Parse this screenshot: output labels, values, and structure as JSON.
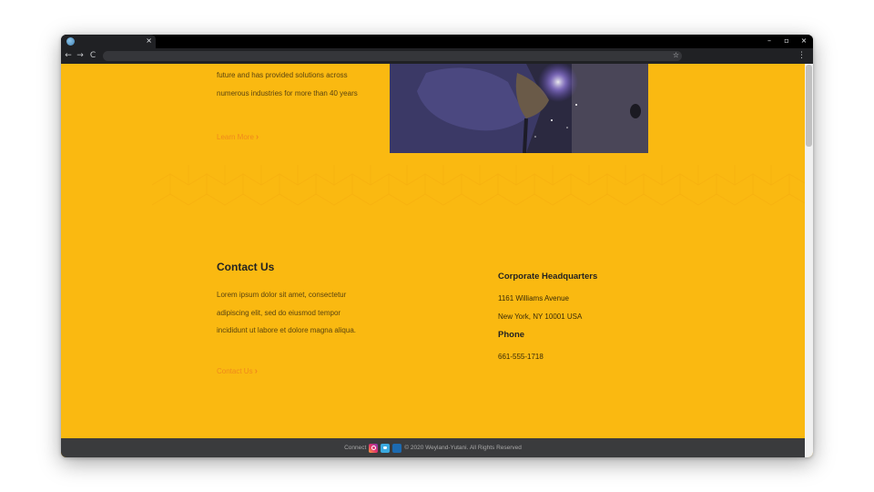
{
  "browser": {
    "tab_close": "×",
    "window_controls": [
      "–",
      "▫",
      "×"
    ],
    "nav": {
      "back": "←",
      "forward": "→",
      "reload": "C"
    },
    "star": "☆",
    "menu": "⋮"
  },
  "about": {
    "text": "future and has provided solutions across numerous industries for more than 40 years",
    "link_label": "Learn More",
    "link_chevron": "›"
  },
  "contact": {
    "title": "Contact Us",
    "text": "Lorem ipsum dolor sit amet, consectetur adipiscing elit, sed do eiusmod tempor incididunt ut labore et dolore magna aliqua.",
    "link_label": "Contact Us",
    "link_chevron": "›"
  },
  "headquarters": {
    "title": "Corporate Headquarters",
    "address_line1": "1161 Williams Avenue",
    "address_line2": "New York, NY 10001 USA",
    "phone_title": "Phone",
    "phone": "661-555-1718"
  },
  "footer": {
    "connect_label": "Connect",
    "social_icons": [
      "instagram-icon",
      "twitter-icon",
      "linkedin-icon"
    ],
    "copyright": "© 2020 Weyland-Yutani. All Rights Reserved"
  },
  "colors": {
    "page_background": "#fab911",
    "link_accent": "#f08a1c",
    "footer_background": "#3a3b3d"
  }
}
